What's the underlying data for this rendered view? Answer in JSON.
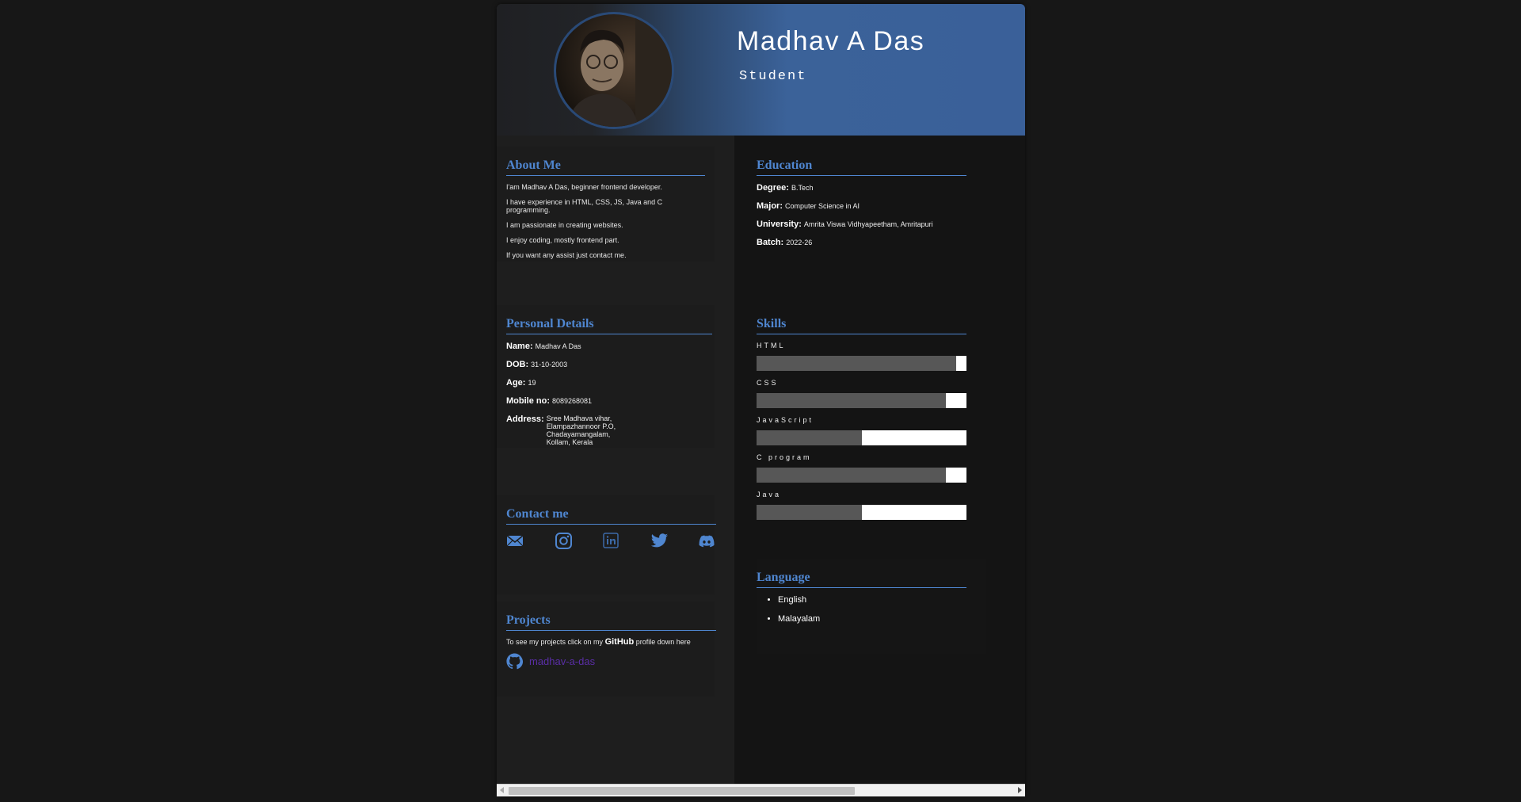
{
  "profile": {
    "name": "Madhav A Das",
    "role": "Student"
  },
  "about": {
    "title": "About Me",
    "lines": [
      "I'am Madhav A Das, beginner frontend developer.",
      "I have experience in HTML, CSS, JS, Java and C programming.",
      "I am passionate in creating websites.",
      "I enjoy coding, mostly frontend part.",
      "If you want any assist just contact me."
    ]
  },
  "education": {
    "title": "Education",
    "items": [
      {
        "label": "Degree:",
        "value": "B.Tech"
      },
      {
        "label": "Major:",
        "value": "Computer Science in AI"
      },
      {
        "label": "University:",
        "value": "Amrita Viswa Vidhyapeetham, Amritapuri"
      },
      {
        "label": "Batch:",
        "value": "2022-26"
      }
    ]
  },
  "personal": {
    "title": "Personal Details",
    "items": [
      {
        "label": "Name:",
        "value": "Madhav A Das"
      },
      {
        "label": "DOB:",
        "value": "31-10-2003"
      },
      {
        "label": "Age:",
        "value": "19"
      },
      {
        "label": "Mobile no:",
        "value": "8089268081"
      }
    ],
    "address_label": "Address:",
    "address_lines": [
      "Sree Madhava vihar,",
      "Elampazhannoor P.O,",
      "Chadayamangalam,",
      "Kollam, Kerala"
    ]
  },
  "skills": {
    "title": "Skills",
    "items": [
      {
        "name": "HTML",
        "level": 0.95
      },
      {
        "name": "CSS",
        "level": 0.9
      },
      {
        "name": "JavaScript",
        "level": 0.5
      },
      {
        "name": "C program",
        "level": 0.9
      },
      {
        "name": "Java",
        "level": 0.5
      }
    ]
  },
  "contact": {
    "title": "Contact me",
    "icons": [
      "mail-icon",
      "instagram-icon",
      "linkedin-icon",
      "twitter-icon",
      "discord-icon"
    ]
  },
  "language": {
    "title": "Language",
    "items": [
      "English",
      "Malayalam"
    ]
  },
  "projects": {
    "title": "Projects",
    "text_before": "To see my projects click on my",
    "github_word": "GitHub",
    "text_after": "profile down here",
    "link": "madhav-a-das"
  },
  "colors": {
    "accent": "#4f86d0",
    "header_blue": "#3a6099",
    "link": "#5a2ea6",
    "bar_fill": "#575757"
  }
}
